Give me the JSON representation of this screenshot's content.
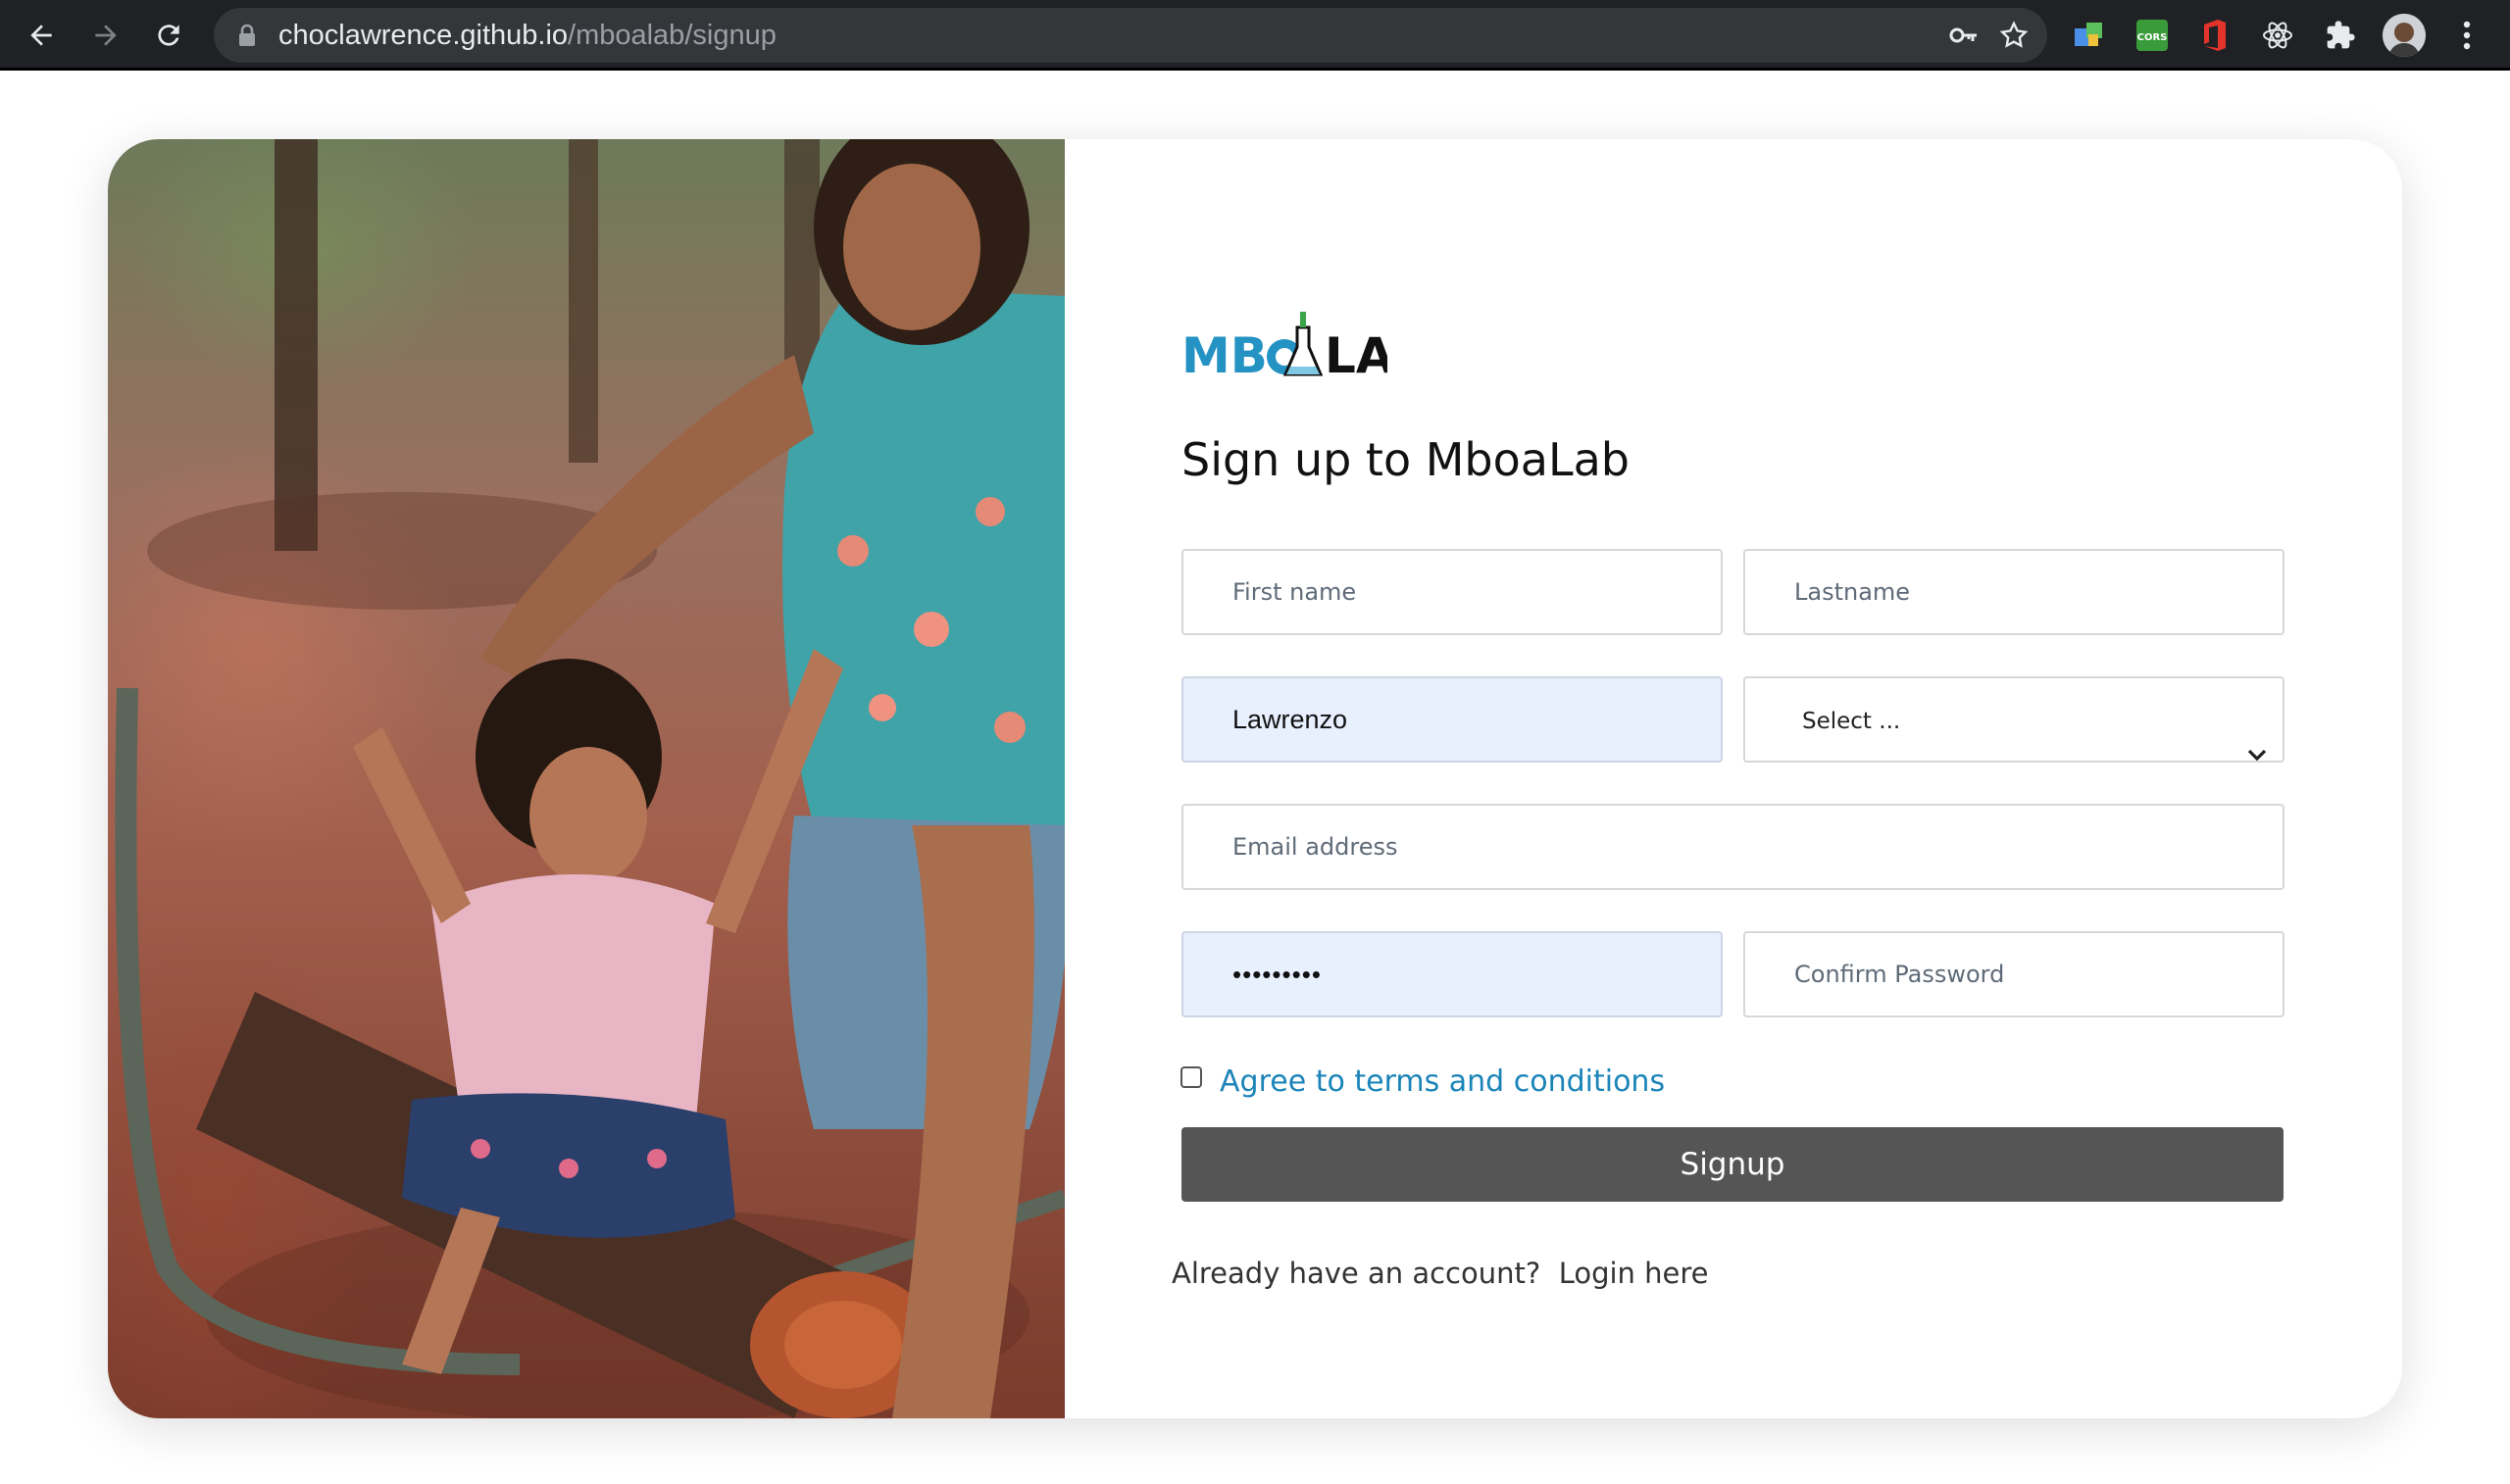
{
  "browser": {
    "url_host": "choclawrence.github.io",
    "url_path": "/mboalab/signup"
  },
  "logo": {
    "text_left": "MB",
    "text_right": "LAB"
  },
  "form": {
    "title": "Sign up to MboaLab",
    "first_name_placeholder": "First name",
    "lastname_placeholder": "Lastname",
    "username_value": "Lawrenzo",
    "select_value": "Select ...",
    "email_placeholder": "Email address",
    "password_value": "•••••••••",
    "confirm_password_placeholder": "Confirm Password",
    "terms_label": "Agree to terms and conditions",
    "signup_label": "Signup",
    "login_prompt": "Already have an account?",
    "login_link": "Login here"
  },
  "colors": {
    "accent": "#1b84b8",
    "button": "#555555",
    "autofill": "#e8f0fe"
  }
}
